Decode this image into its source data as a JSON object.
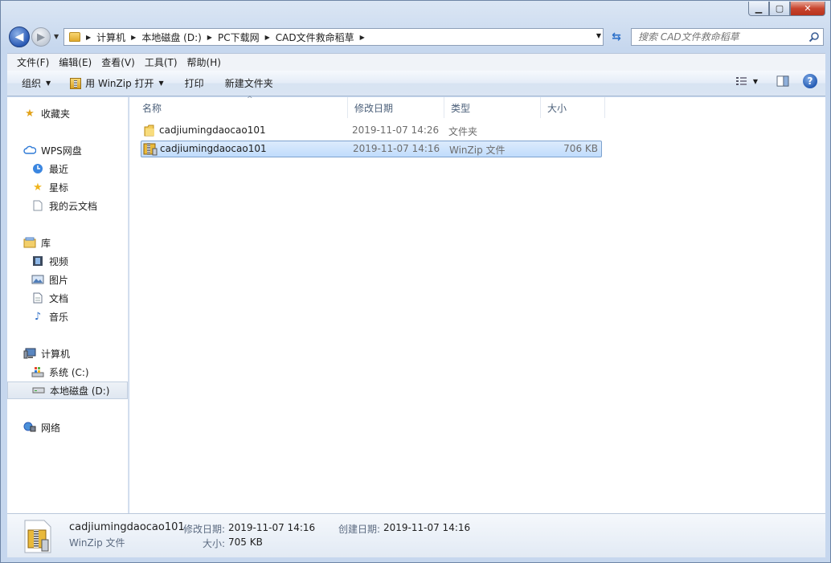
{
  "window": {
    "minimize_glyph": "▁",
    "maximize_glyph": "▢",
    "close_glyph": "✕"
  },
  "address": {
    "crumbs": [
      "计算机",
      "本地磁盘 (D:)",
      "PC下载网",
      "CAD文件救命稻草"
    ],
    "search_placeholder": "搜索 CAD文件救命稻草"
  },
  "menubar": {
    "items": [
      "文件(F)",
      "编辑(E)",
      "查看(V)",
      "工具(T)",
      "帮助(H)"
    ]
  },
  "cmdbar": {
    "organize": "组织",
    "open_with": "用 WinZip 打开",
    "print": "打印",
    "new_folder": "新建文件夹",
    "help": "?"
  },
  "sidebar": {
    "favorites": "收藏夹",
    "wps": "WPS网盘",
    "recent": "最近",
    "starred": "星标",
    "cloud_docs": "我的云文档",
    "libraries": "库",
    "videos": "视频",
    "pictures": "图片",
    "documents": "文档",
    "music": "音乐",
    "computer": "计算机",
    "drive_c": "系统 (C:)",
    "drive_d": "本地磁盘 (D:)",
    "network": "网络"
  },
  "columns": {
    "name": "名称",
    "modified": "修改日期",
    "type": "类型",
    "size": "大小"
  },
  "files": [
    {
      "name": "cadjiumingdaocao101",
      "modified": "2019-11-07 14:26",
      "type": "文件夹",
      "size": ""
    },
    {
      "name": "cadjiumingdaocao101",
      "modified": "2019-11-07 14:16",
      "type": "WinZip 文件",
      "size": "706 KB"
    }
  ],
  "details": {
    "name": "cadjiumingdaocao101",
    "type": "WinZip 文件",
    "modified_label": "修改日期:",
    "modified_value": "2019-11-07 14:16",
    "created_label": "创建日期:",
    "created_value": "2019-11-07 14:16",
    "size_label": "大小:",
    "size_value": "705 KB"
  },
  "colors": {
    "selection": "#c1dcfc",
    "accent": "#2a5ab5"
  }
}
